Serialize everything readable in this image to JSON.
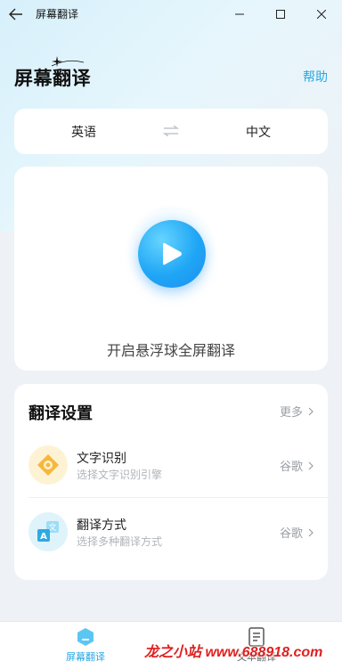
{
  "window": {
    "title": "屏幕翻译"
  },
  "header": {
    "title": "屏幕翻译",
    "help_label": "帮助"
  },
  "languages": {
    "source": "英语",
    "target": "中文",
    "swap_icon": "swap-arrows-icon"
  },
  "floating": {
    "action_text": "开启悬浮球全屏翻译",
    "icon": "play-icon"
  },
  "settings": {
    "title": "翻译设置",
    "more_label": "更多",
    "items": [
      {
        "label": "文字识别",
        "subtitle": "选择文字识别引擎",
        "value": "谷歌",
        "icon": "text-recognition-icon",
        "icon_bg": "#fdf3d4"
      },
      {
        "label": "翻译方式",
        "subtitle": "选择多种翻译方式",
        "value": "谷歌",
        "icon": "translate-icon",
        "icon_bg": "#dff3fb"
      }
    ]
  },
  "nav": {
    "items": [
      {
        "label": "屏幕翻译",
        "active": true,
        "icon": "screen-translate-icon"
      },
      {
        "label": "文本翻译",
        "active": false,
        "icon": "document-icon"
      }
    ]
  },
  "watermark": {
    "text": "龙之小站 www.688918.com"
  },
  "colors": {
    "accent": "#2aa7e0",
    "play": "#1fa6f5",
    "text_primary": "#111111",
    "text_secondary": "#9aa0a6",
    "watermark": "#e02020"
  }
}
